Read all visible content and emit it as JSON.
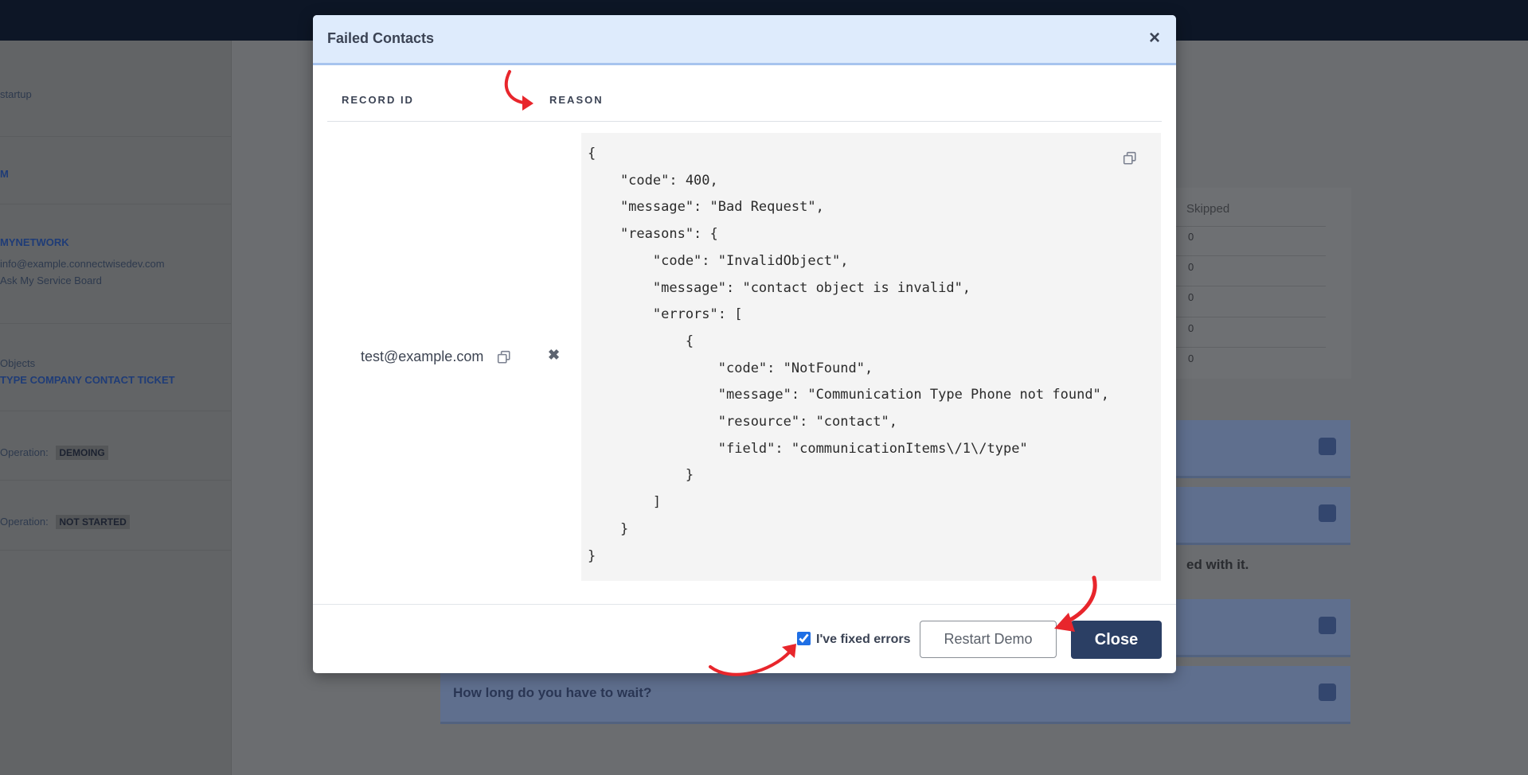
{
  "background": {
    "sidebar": {
      "top_text": "startup",
      "item_1": "M",
      "section_title": "MYNETWORK",
      "email": "info@example.connectwisedev.com",
      "board": "Ask My Service Board",
      "label_a": "Objects",
      "link_a": "TYPE COMPANY CONTACT TICKET",
      "operation_1_label": "Operation:",
      "operation_1_badge": "DEMOING",
      "operation_2_label": "Operation:",
      "operation_2_badge": "NOT STARTED"
    },
    "table": {
      "header": "Skipped",
      "values": [
        "0",
        "0",
        "0",
        "0",
        "0"
      ]
    },
    "accordions": [
      {
        "label": ""
      },
      {
        "label": ""
      },
      {
        "label": ""
      },
      {
        "label": "How long do you have to wait?"
      }
    ],
    "partial_text": "ed with it."
  },
  "modal": {
    "title": "Failed Contacts",
    "close_symbol": "×",
    "columns": {
      "record_id": "RECORD ID",
      "reason": "REASON"
    },
    "rows": [
      {
        "record_id": "test@example.com",
        "remove_symbol": "✖",
        "reason": "{\n    \"code\": 400,\n    \"message\": \"Bad Request\",\n    \"reasons\": {\n        \"code\": \"InvalidObject\",\n        \"message\": \"contact object is invalid\",\n        \"errors\": [\n            {\n                \"code\": \"NotFound\",\n                \"message\": \"Communication Type Phone not found\",\n                \"resource\": \"contact\",\n                \"field\": \"communicationItems\\/1\\/type\"\n            }\n        ]\n    }\n}"
      }
    ],
    "footer": {
      "checkbox_label": "I've fixed errors",
      "checkbox_checked": true,
      "restart_label": "Restart Demo",
      "close_label": "Close"
    }
  },
  "colors": {
    "header_bg": "#deebfc",
    "primary_button": "#2b3f64",
    "annotation": "#e8262c"
  },
  "icons": {
    "copy": "copy-icon",
    "remove": "remove-icon",
    "close": "close-icon"
  }
}
